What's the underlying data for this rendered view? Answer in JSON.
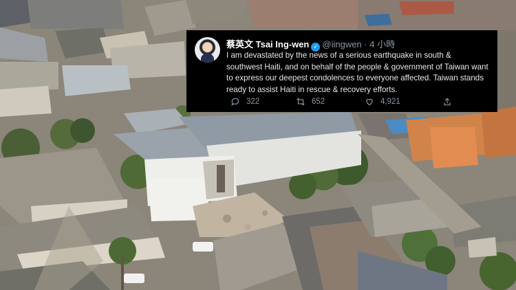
{
  "tweet": {
    "author_name": "蔡英文 Tsai Ing-wen",
    "handle": "@iingwen",
    "separator": "·",
    "time": "4 小時",
    "text": "I am devastated by the news of a serious earthquake in south & southwest Haiti, and on behalf of the people & government of Taiwan want to express our deepest condolences to everyone affected. Taiwan stands ready to assist Haiti in rescue & recovery efforts.",
    "reply_count": "322",
    "retweet_count": "652",
    "like_count": "4,921"
  },
  "colors": {
    "tweet_background": "#000000",
    "verified_badge": "#1d9bf0",
    "muted_text": "#8b98a5"
  },
  "icons": [
    "reply-icon",
    "retweet-icon",
    "like-icon",
    "share-icon",
    "verified-badge-icon"
  ]
}
